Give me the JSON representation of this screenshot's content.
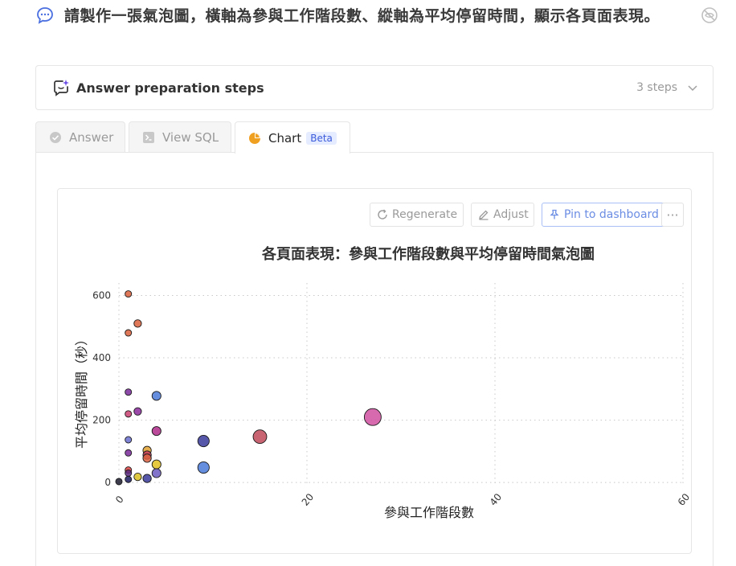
{
  "question": {
    "text": "請製作一張氣泡圖，橫軸為參與工作階段數、縱軸為平均停留時間，顯示各頁面表現。"
  },
  "steps": {
    "title": "Answer preparation steps",
    "count": "3 steps"
  },
  "tabs": {
    "answer": "Answer",
    "sql": "View SQL",
    "chart": "Chart",
    "beta": "Beta"
  },
  "toolbar": {
    "regenerate": "Regenerate",
    "adjust": "Adjust",
    "pin": "Pin to dashboard",
    "more": "···"
  },
  "colors": {
    "accent": "#3b5bdb",
    "chart_tab_icon": "#f0a020"
  },
  "chart_data": {
    "type": "scatter",
    "title": "各頁面表現：參與工作階段數與平均停留時間氣泡圖",
    "xlabel": "參與工作階段數",
    "ylabel": "平均停留時間（秒）",
    "xlim": [
      0,
      60
    ],
    "ylim": [
      -10,
      640
    ],
    "xticks": [
      0,
      20,
      40,
      60
    ],
    "yticks": [
      0,
      200,
      400,
      600
    ],
    "grid": true,
    "legend": "none",
    "points": [
      {
        "x": 0,
        "y": 3,
        "size": 1,
        "color": "#1b1b2f"
      },
      {
        "x": 1,
        "y": 605,
        "size": 1,
        "color": "#d9603b"
      },
      {
        "x": 1,
        "y": 480,
        "size": 1,
        "color": "#d9603b"
      },
      {
        "x": 1,
        "y": 290,
        "size": 1,
        "color": "#7a2a9a"
      },
      {
        "x": 1,
        "y": 220,
        "size": 1,
        "color": "#c94070"
      },
      {
        "x": 1,
        "y": 137,
        "size": 1,
        "color": "#6a6fd0"
      },
      {
        "x": 1,
        "y": 95,
        "size": 1,
        "color": "#7a2a9a"
      },
      {
        "x": 1,
        "y": 40,
        "size": 1,
        "color": "#d94040"
      },
      {
        "x": 1,
        "y": 30,
        "size": 1,
        "color": "#5a2a80"
      },
      {
        "x": 1,
        "y": 10,
        "size": 1,
        "color": "#1b1b5f"
      },
      {
        "x": 2,
        "y": 510,
        "size": 2,
        "color": "#d9603b"
      },
      {
        "x": 2,
        "y": 228,
        "size": 2,
        "color": "#8a2a9a"
      },
      {
        "x": 2,
        "y": 18,
        "size": 2,
        "color": "#d9c020"
      },
      {
        "x": 3,
        "y": 103,
        "size": 3,
        "color": "#e0a030"
      },
      {
        "x": 3,
        "y": 88,
        "size": 3,
        "color": "#c43a5a"
      },
      {
        "x": 3,
        "y": 78,
        "size": 3,
        "color": "#d96040"
      },
      {
        "x": 3,
        "y": 13,
        "size": 3,
        "color": "#3a3a9a"
      },
      {
        "x": 4,
        "y": 278,
        "size": 4,
        "color": "#4a7ad9"
      },
      {
        "x": 4,
        "y": 165,
        "size": 4,
        "color": "#b02a8a"
      },
      {
        "x": 4,
        "y": 58,
        "size": 4,
        "color": "#e0c020"
      },
      {
        "x": 4,
        "y": 30,
        "size": 4,
        "color": "#6a5ac0"
      },
      {
        "x": 9,
        "y": 133,
        "size": 9,
        "color": "#3a3a9a"
      },
      {
        "x": 9,
        "y": 48,
        "size": 9,
        "color": "#4a7ad9"
      },
      {
        "x": 15,
        "y": 147,
        "size": 15,
        "color": "#c04a5a"
      },
      {
        "x": 27,
        "y": 210,
        "size": 27,
        "color": "#d050a0"
      }
    ]
  }
}
